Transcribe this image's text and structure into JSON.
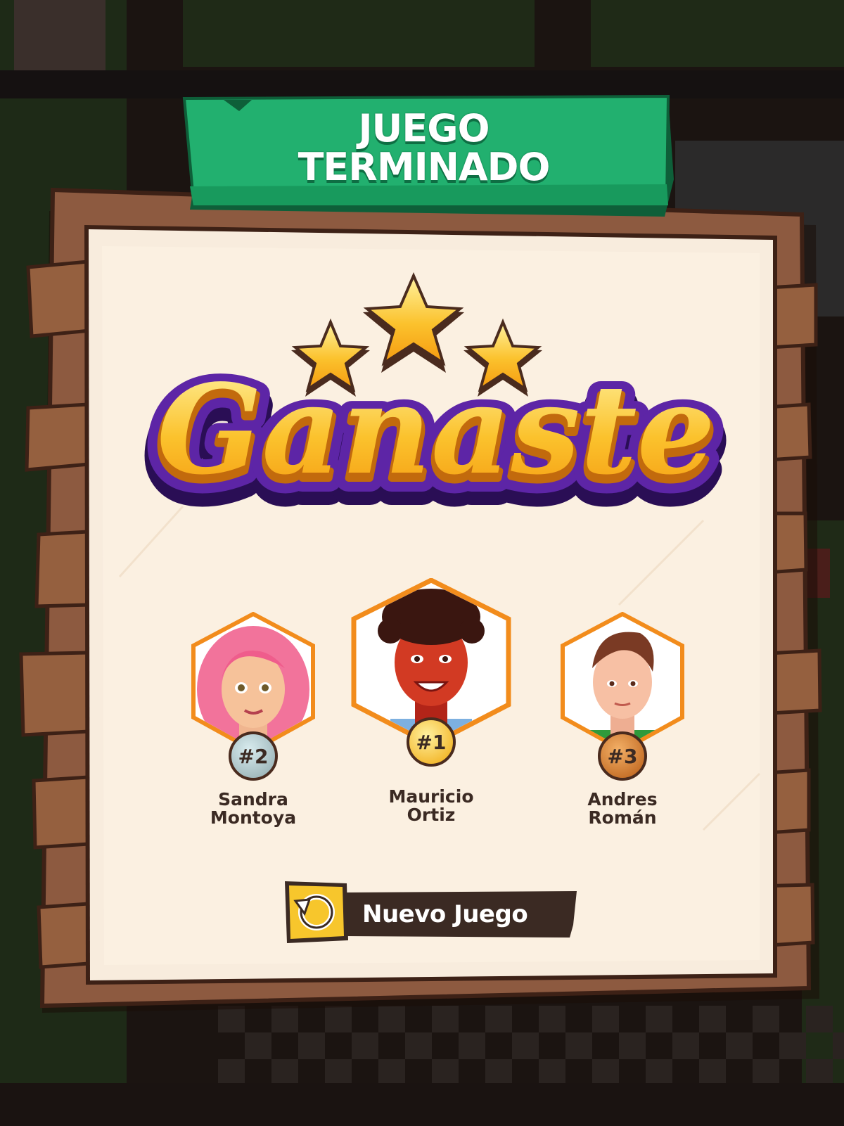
{
  "banner": {
    "line1": "JUEGO",
    "line2": "TERMINADO"
  },
  "headline": {
    "text": "Ganaste",
    "stars": 3
  },
  "players": [
    {
      "name_line1": "Sandra",
      "name_line2": "Montoya",
      "rank": "#2",
      "avatar": "woman-pink-hair-avatar",
      "badge_color": "#9fb7bb"
    },
    {
      "name_line1": "Mauricio",
      "name_line2": "Ortiz",
      "rank": "#1",
      "avatar": "man-curly-hair-avatar",
      "badge_color": "#f3b712"
    },
    {
      "name_line1": "Andres",
      "name_line2": "Román",
      "rank": "#3",
      "avatar": "man-short-hair-avatar",
      "badge_color": "#c96c1d"
    }
  ],
  "actions": {
    "new_game_label": "Nuevo Juego",
    "new_game_icon": "restart-icon"
  },
  "colors": {
    "banner_green": "#22b06f",
    "wood": "#8d5a40",
    "paper": "#f8ecdd",
    "gold": "#fbc22d",
    "purple": "#4b1d8a",
    "orange_frame": "#f28c1c"
  }
}
